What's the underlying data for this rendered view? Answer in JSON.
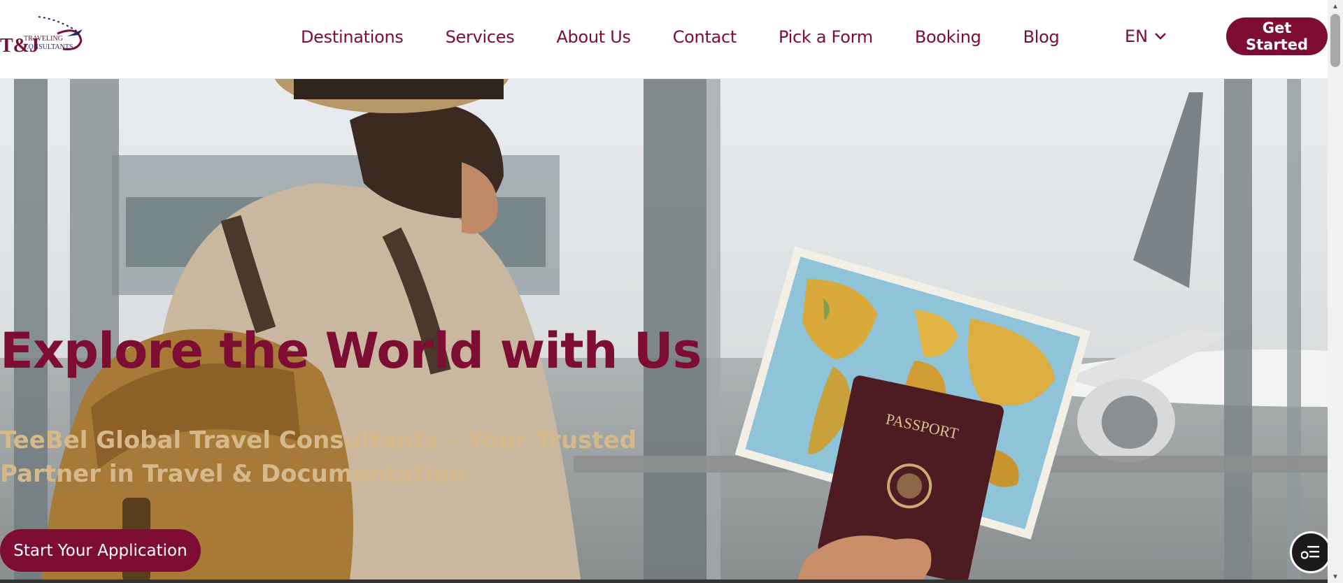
{
  "header": {
    "logo_text_line1": "TRAVELING",
    "logo_text_line2": "CONSULTANTS",
    "logo_monogram": "T&J",
    "nav": [
      "Destinations",
      "Services",
      "About Us",
      "Contact",
      "Pick a Form",
      "Booking",
      "Blog"
    ],
    "language": "EN",
    "cta_label": "Get Started"
  },
  "hero": {
    "title": "Explore the World with Us",
    "subtitle": "TeeBel Global Travel Consultants – Your Trusted Partner in Travel & Documentation",
    "button_label": "Start Your Application",
    "passport_text": "PASSPORT"
  },
  "icons": {
    "language_chevron": "chevron-down-icon",
    "floating_button": "accessibility-menu-icon"
  },
  "colors": {
    "brand": "#7d0d32",
    "subtitle": "#d6b98a",
    "header_bg": "#ffffff"
  }
}
